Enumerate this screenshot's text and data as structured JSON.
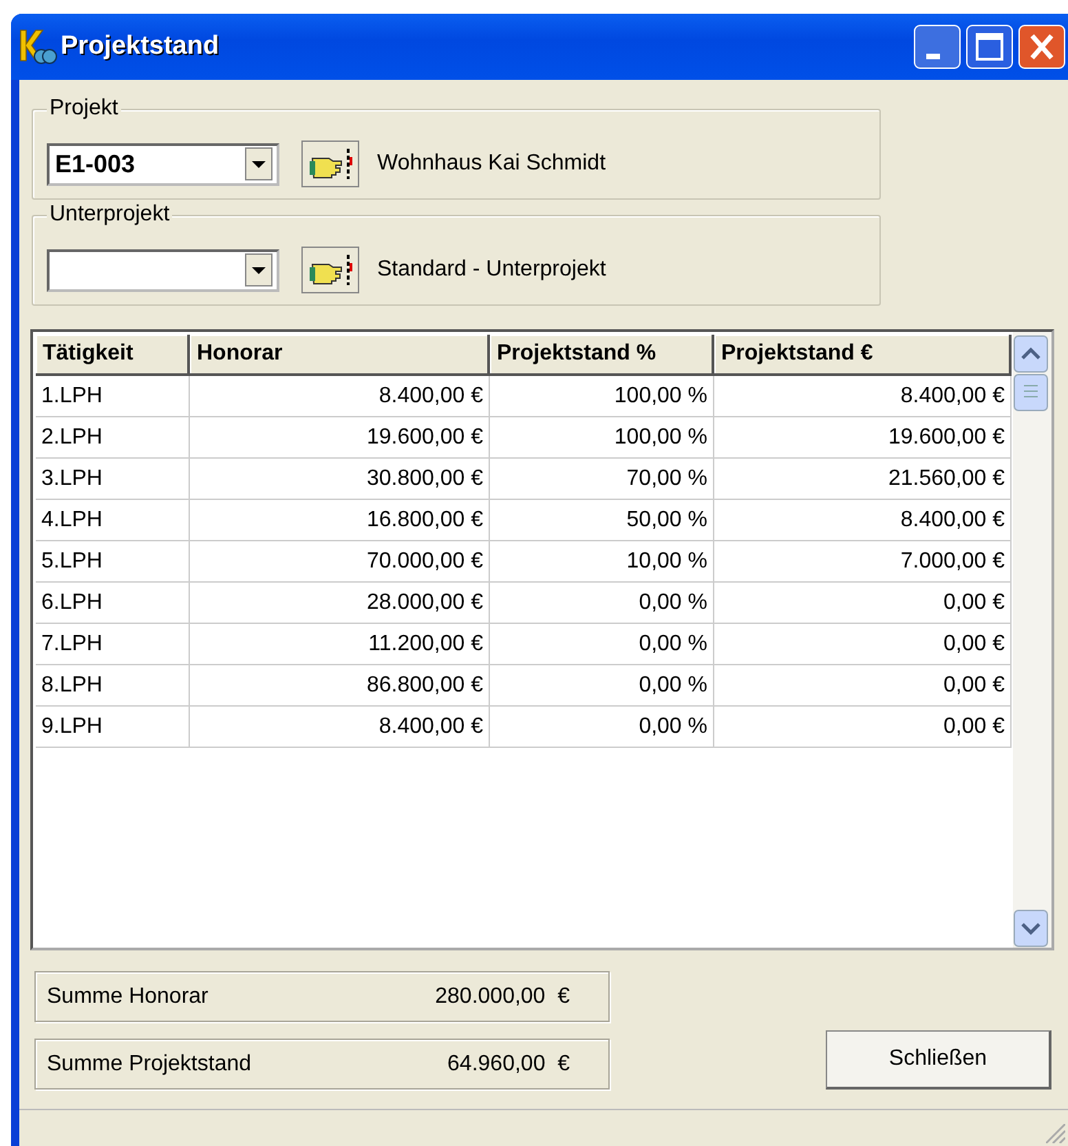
{
  "window": {
    "title": "Projektstand"
  },
  "selectors": [
    {
      "label": "Projekt",
      "value": "E1-003",
      "description": "Wohnhaus Kai Schmidt"
    },
    {
      "label": "Unterprojekt",
      "description": "Standard - Unterprojekt"
    }
  ],
  "table": {
    "columns": [
      "Tätigkeit",
      "Honorar",
      "Projektstand %",
      "Projektstand €"
    ],
    "rows": [
      [
        "1.LPH",
        "8.400,00 €",
        "100,00 %",
        "8.400,00 €"
      ],
      [
        "2.LPH",
        "19.600,00 €",
        "100,00 %",
        "19.600,00 €"
      ],
      [
        "3.LPH",
        "30.800,00 €",
        "70,00 %",
        "21.560,00 €"
      ],
      [
        "4.LPH",
        "16.800,00 €",
        "50,00 %",
        "8.400,00 €"
      ],
      [
        "5.LPH",
        "70.000,00 €",
        "10,00 %",
        "7.000,00 €"
      ],
      [
        "6.LPH",
        "28.000,00 €",
        "0,00 %",
        "0,00 €"
      ],
      [
        "7.LPH",
        "11.200,00 €",
        "0,00 %",
        "0,00 €"
      ],
      [
        "8.LPH",
        "86.800,00 €",
        "0,00 %",
        "0,00 €"
      ],
      [
        "9.LPH",
        "8.400,00 €",
        "0,00 %",
        "0,00 €"
      ]
    ]
  },
  "totals": [
    {
      "label": "Summe Honorar",
      "value": "280.000,00  €"
    },
    {
      "label": "Summe Projektstand",
      "value": "64.960,00  €"
    }
  ],
  "close_button": "Schließen"
}
